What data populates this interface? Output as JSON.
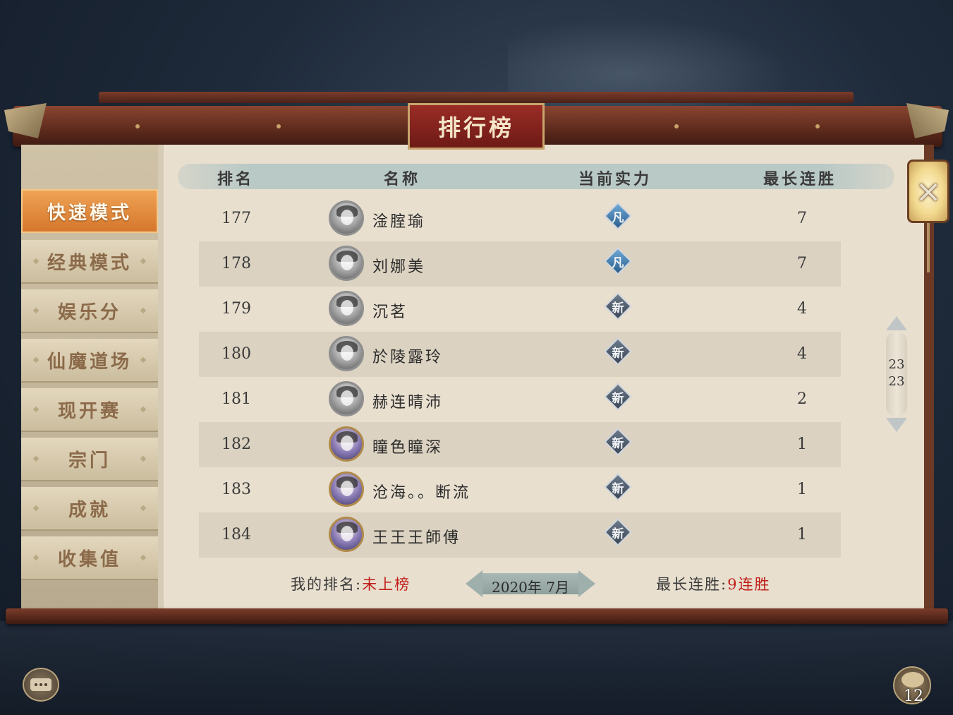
{
  "title": "排行榜",
  "sidebar": {
    "items": [
      {
        "label": "快速模式",
        "active": true
      },
      {
        "label": "经典模式",
        "active": false
      },
      {
        "label": "娱乐分",
        "active": false
      },
      {
        "label": "仙魔道场",
        "active": false
      },
      {
        "label": "现开赛",
        "active": false
      },
      {
        "label": "宗门",
        "active": false
      },
      {
        "label": "成就",
        "active": false
      },
      {
        "label": "收集值",
        "active": false
      }
    ]
  },
  "table": {
    "columns": [
      "排名",
      "名称",
      "当前实力",
      "最长连胜"
    ],
    "rows": [
      {
        "rank": "177",
        "name": "淦腟瑜",
        "power": "凡",
        "streak": "7"
      },
      {
        "rank": "178",
        "name": "刘娜美",
        "power": "凡",
        "streak": "7"
      },
      {
        "rank": "179",
        "name": "沉茗",
        "power": "新",
        "streak": "4"
      },
      {
        "rank": "180",
        "name": "於陵露玲",
        "power": "新",
        "streak": "4"
      },
      {
        "rank": "181",
        "name": "赫连晴沛",
        "power": "新",
        "streak": "2"
      },
      {
        "rank": "182",
        "name": "瞳色瞳深",
        "power": "新",
        "streak": "1"
      },
      {
        "rank": "183",
        "name": "沧海。。断流",
        "power": "新",
        "streak": "1"
      },
      {
        "rank": "184",
        "name": "王王王師傅",
        "power": "新",
        "streak": "1"
      }
    ]
  },
  "footer": {
    "my_rank_label": "我的排名:",
    "my_rank_value": "未上榜",
    "date": "2020年 7月",
    "best_streak_label": "最长连胜:",
    "best_streak_value": "9连胜"
  },
  "pager": {
    "current": "23",
    "total": "23"
  },
  "close_icon": "×",
  "team_count": "12",
  "icons": {
    "close": "close-icon",
    "chat": "chat-icon",
    "team": "team-icon"
  }
}
